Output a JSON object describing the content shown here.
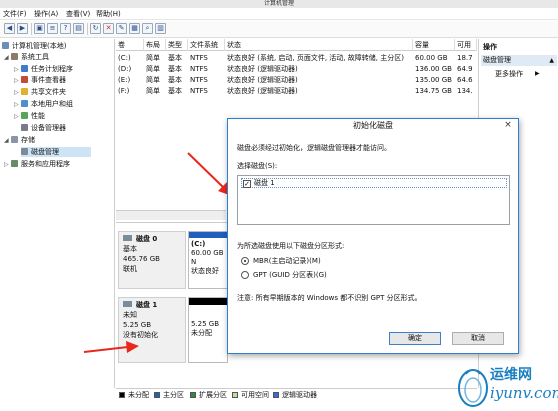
{
  "window": {
    "title": "计算机管理"
  },
  "menu": [
    "文件(F)",
    "操作(A)",
    "查看(V)",
    "帮助(H)"
  ],
  "toolbar_icons": [
    "back-arrow-icon",
    "forward-arrow-icon",
    "folder-up-icon",
    "list-view-icon",
    "help-icon",
    "properties-icon",
    "refresh-icon",
    "delete-icon",
    "new-icon",
    "open-icon",
    "search-icon",
    "more-icon"
  ],
  "tree": [
    {
      "label": "计算机管理(本地)",
      "level": 0,
      "icon": "computer-icon"
    },
    {
      "label": "系统工具",
      "level": 1,
      "icon": "tools-icon"
    },
    {
      "label": "任务计划程序",
      "level": 2,
      "icon": "clock-icon"
    },
    {
      "label": "事件查看器",
      "level": 2,
      "icon": "event-icon"
    },
    {
      "label": "共享文件夹",
      "level": 2,
      "icon": "folder-icon"
    },
    {
      "label": "本地用户和组",
      "level": 2,
      "icon": "users-icon"
    },
    {
      "label": "性能",
      "level": 2,
      "icon": "performance-icon"
    },
    {
      "label": "设备管理器",
      "level": 2,
      "icon": "device-icon"
    },
    {
      "label": "存储",
      "level": 1,
      "icon": "storage-icon"
    },
    {
      "label": "磁盘管理",
      "level": 2,
      "icon": "disk-icon",
      "selected": true
    },
    {
      "label": "服务和应用程序",
      "level": 1,
      "icon": "services-icon"
    }
  ],
  "volumes": {
    "columns": [
      "卷",
      "布局",
      "类型",
      "文件系统",
      "状态",
      "容量",
      "可用"
    ],
    "rows": [
      [
        "(C:)",
        "简单",
        "基本",
        "NTFS",
        "状态良好 (系统, 启动, 页面文件, 活动, 故障转储, 主分区)",
        "60.00 GB",
        "18.7"
      ],
      [
        "(D:)",
        "简单",
        "基本",
        "NTFS",
        "状态良好 (逻辑驱动器)",
        "136.00 GB",
        "64.9"
      ],
      [
        "(E:)",
        "简单",
        "基本",
        "NTFS",
        "状态良好 (逻辑驱动器)",
        "135.00 GB",
        "64.6"
      ],
      [
        "(F:)",
        "简单",
        "基本",
        "NTFS",
        "状态良好 (逻辑驱动器)",
        "134.75 GB",
        "134."
      ]
    ]
  },
  "disks": [
    {
      "name": "磁盘 0",
      "type": "基本",
      "size": "465.76 GB",
      "status": "联机",
      "volume": {
        "label": "(C:)",
        "size": "60.00 GB N",
        "status": "状态良好"
      }
    },
    {
      "name": "磁盘 1",
      "type": "未知",
      "size": "5.25 GB",
      "status": "没有初始化",
      "volume": {
        "size": "5.25 GB",
        "status": "未分配"
      }
    }
  ],
  "legend": [
    {
      "label": "未分配",
      "color": "#000000"
    },
    {
      "label": "主分区",
      "color": "#1f5fbf"
    },
    {
      "label": "扩展分区",
      "color": "#2e8b3a"
    },
    {
      "label": "可用空间",
      "color": "#b5e3a5"
    },
    {
      "label": "逻辑驱动器",
      "color": "#3a6ad8"
    }
  ],
  "actions": {
    "header": "操作",
    "section": "磁盘管理",
    "items": [
      "更多操作"
    ]
  },
  "dialog": {
    "title": "初始化磁盘",
    "intro": "磁盘必须经过初始化，逻辑磁盘管理器才能访问。",
    "select_label": "选择磁盘(S):",
    "disk_items": [
      {
        "label": "磁盘 1",
        "checked": true
      }
    ],
    "style_label": "为所选磁盘使用以下磁盘分区形式:",
    "options": [
      {
        "label": "MBR(主启动记录)(M)",
        "selected": true
      },
      {
        "label": "GPT (GUID 分区表)(G)",
        "selected": false
      }
    ],
    "note": "注意: 所有早期版本的 Windows 都不识别 GPT 分区形式。",
    "ok": "确定",
    "cancel": "取消"
  },
  "watermark": {
    "cn": "运维网",
    "en": "iyunv.com"
  },
  "colors": {
    "accent": "#2c7fd1",
    "arrow": "#e8281e",
    "selection": "#cde4f7"
  }
}
